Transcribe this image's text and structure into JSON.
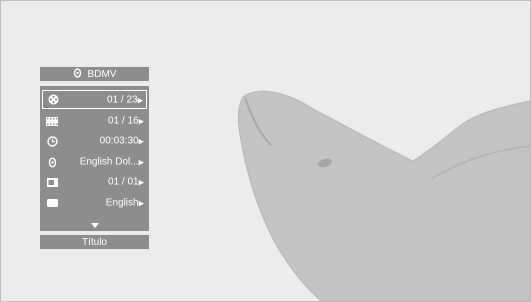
{
  "header": {
    "label": "BDMV",
    "icon": "disc-audio-icon"
  },
  "items": [
    {
      "icon": "film-reel-icon",
      "value": "01 / 23"
    },
    {
      "icon": "film-strip-icon",
      "value": "01 / 16"
    },
    {
      "icon": "clock-icon",
      "value": "00:03:30"
    },
    {
      "icon": "audio-disc-icon",
      "value": "English Dol..."
    },
    {
      "icon": "angle-camera-icon",
      "value": "01 / 01"
    },
    {
      "icon": "subtitle-icon",
      "value": "English"
    }
  ],
  "footer": {
    "label": "Título"
  },
  "colors": {
    "panel": "#8d8d8d",
    "background": "#ececec",
    "dolphin": "#c4c4c4"
  }
}
